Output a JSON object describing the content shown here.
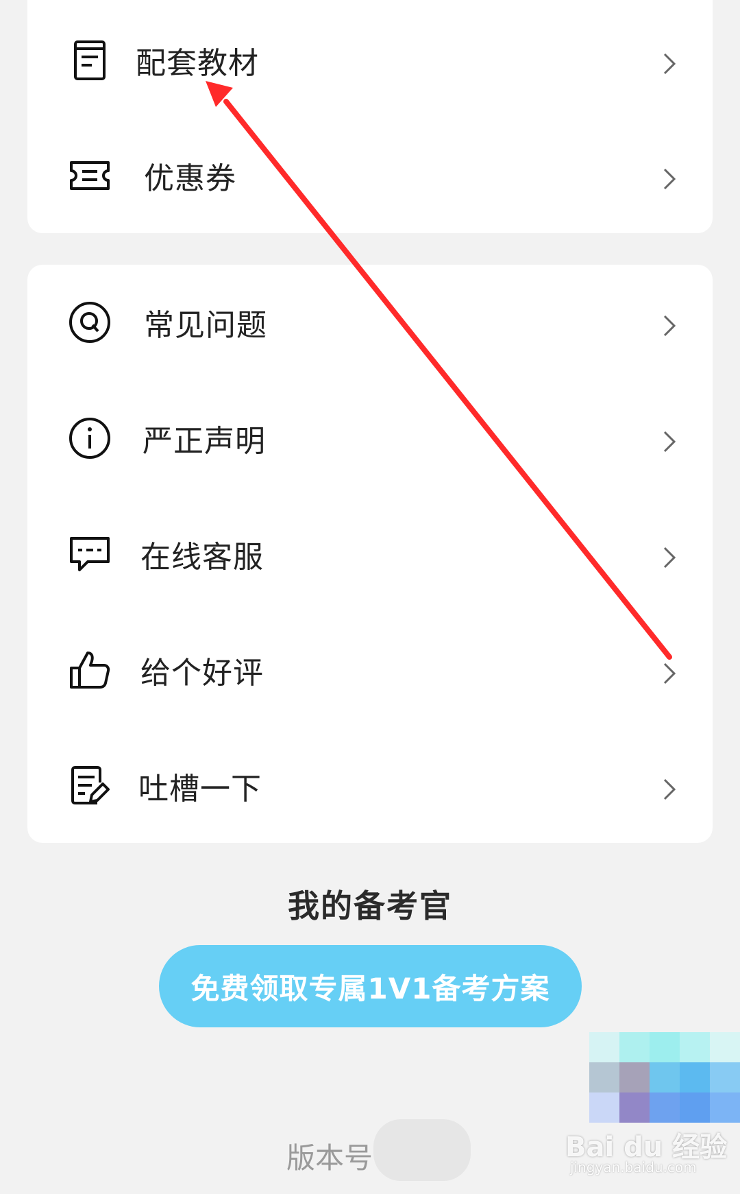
{
  "menu_group_1": [
    {
      "label": "配套教材",
      "icon": "textbook-icon"
    },
    {
      "label": "优惠券",
      "icon": "coupon-icon"
    }
  ],
  "menu_group_2": [
    {
      "label": "常见问题",
      "icon": "faq-icon"
    },
    {
      "label": "严正声明",
      "icon": "info-icon"
    },
    {
      "label": "在线客服",
      "icon": "chat-icon"
    },
    {
      "label": "给个好评",
      "icon": "thumbs-up-icon"
    },
    {
      "label": "吐槽一下",
      "icon": "feedback-icon"
    }
  ],
  "advisor": {
    "title": "我的备考官",
    "cta_label": "免费领取专属1V1备考方案"
  },
  "footer": {
    "version_label": "版本号"
  },
  "watermark": {
    "brand": "Bai du 经验",
    "url": "jingyan.baidu.com"
  },
  "colors": {
    "background": "#f2f2f2",
    "card": "#ffffff",
    "cta": "#66cff5",
    "annotation_arrow": "#ff2a2a"
  }
}
